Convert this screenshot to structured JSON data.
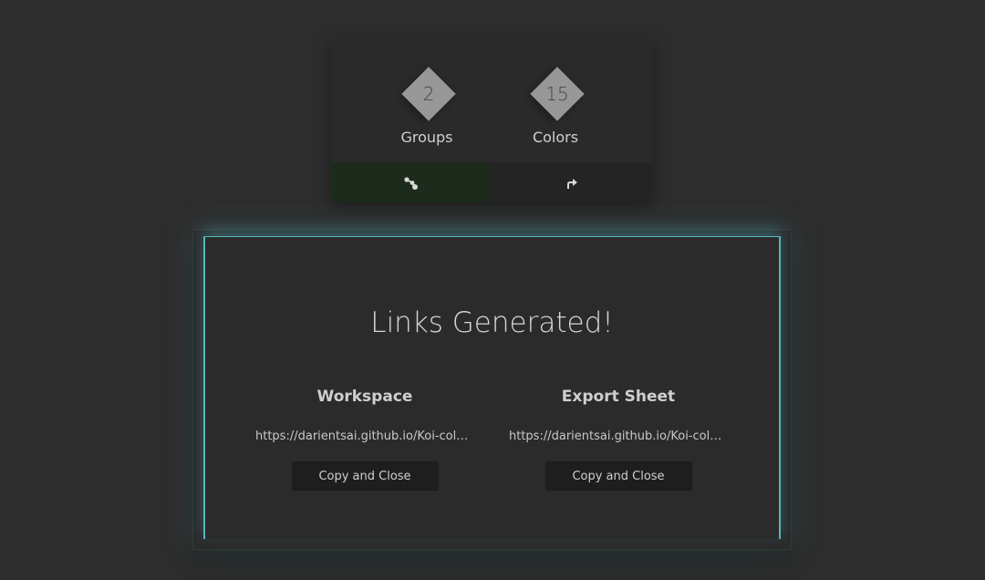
{
  "stats": {
    "groups": {
      "value": "2",
      "label": "Groups"
    },
    "colors": {
      "value": "15",
      "label": "Colors"
    }
  },
  "actions": {
    "share_icon": "share-icon",
    "export_icon": "export-arrow-icon"
  },
  "modal": {
    "title": "Links Generated!",
    "workspace": {
      "heading": "Workspace",
      "link": "https://darientsai.github.io/Koi-color-...",
      "button": "Copy and Close"
    },
    "export_sheet": {
      "heading": "Export Sheet",
      "link": "https://darientsai.github.io/Koi-color-...",
      "button": "Copy and Close"
    }
  },
  "colors": {
    "background": "#2d2d2d",
    "accent": "#54b6bf",
    "share_bg": "#1d2b1c"
  }
}
